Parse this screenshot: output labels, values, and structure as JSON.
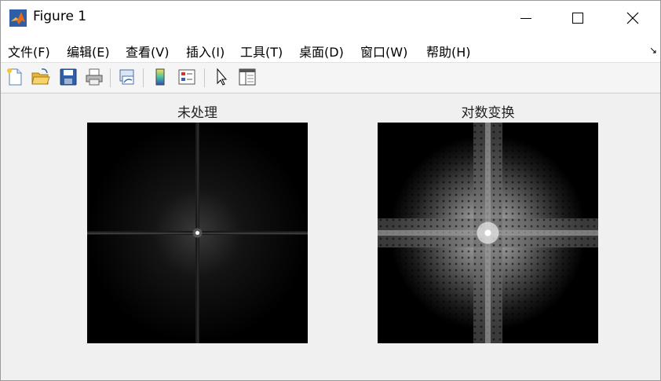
{
  "window": {
    "title": "Figure 1"
  },
  "menu": [
    {
      "label": "文件(F)"
    },
    {
      "label": "编辑(E)"
    },
    {
      "label": "查看(V)"
    },
    {
      "label": "插入(I)"
    },
    {
      "label": "工具(T)"
    },
    {
      "label": "桌面(D)"
    },
    {
      "label": "窗口(W)"
    },
    {
      "label": "帮助(H)"
    }
  ],
  "toolbar": {
    "icons": [
      "new-figure-icon",
      "open-file-icon",
      "save-icon",
      "print-icon",
      "link-figure-icon",
      "colorbar-icon",
      "legend-icon",
      "edit-plot-icon",
      "property-inspector-icon"
    ]
  },
  "axes": [
    {
      "title": "未处理"
    },
    {
      "title": "对数变换"
    }
  ],
  "colors": {
    "titlebar": "#ffffff",
    "figure_bg": "#f0f0f0",
    "image_bg": "#000000"
  }
}
